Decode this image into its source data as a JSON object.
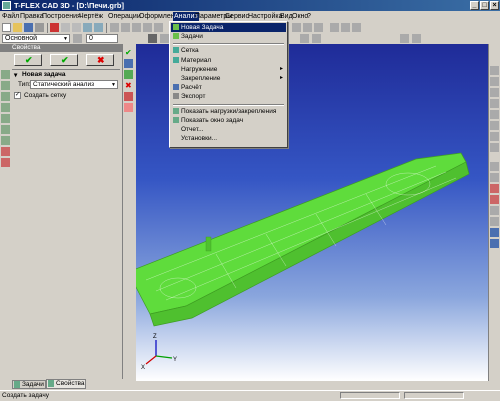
{
  "window": {
    "title": "T-FLEX CAD 3D - [D:\\Печи.grb]"
  },
  "menu": [
    "Файл",
    "Правка",
    "Построения",
    "Чертёж",
    "Операции",
    "Оформление",
    "Анализ",
    "Параметры",
    "Сервис",
    "Настройка",
    "Вид",
    "Окно",
    "?"
  ],
  "active_menu_index": 6,
  "toolbar": {
    "layer_value": "Основной",
    "number_value": "0"
  },
  "panel": {
    "header": "Свойства",
    "section_title": "Новая задача",
    "type_label": "Тип:",
    "type_value": "Статический анализ",
    "create_mesh_label": "Создать сетку",
    "create_mesh_checked": true,
    "tabs": [
      "Задачи",
      "Свойства"
    ]
  },
  "analysis_menu": {
    "items": [
      {
        "label": "Новая Задача",
        "icon": "new-task-icon",
        "highlight": true
      },
      {
        "label": "Задачи",
        "icon": "tasks-icon"
      },
      {
        "sep": true
      },
      {
        "label": "Сетка",
        "icon": "mesh-icon"
      },
      {
        "label": "Материал",
        "icon": "material-icon"
      },
      {
        "label": "Нагружение",
        "submenu": true
      },
      {
        "label": "Закрепление",
        "submenu": true
      },
      {
        "label": "Расчёт",
        "icon": "calculate-icon"
      },
      {
        "label": "Экспорт",
        "icon": "export-icon"
      },
      {
        "sep": true
      },
      {
        "label": "Показать нагрузки/закрепления",
        "icon": "show-loads-icon"
      },
      {
        "label": "Показать окно задач",
        "icon": "show-tasks-window-icon"
      },
      {
        "label": "Отчет..."
      },
      {
        "label": "Установки..."
      }
    ]
  },
  "status": {
    "text": "Создать задачу"
  },
  "colors": {
    "model_green": "#5fdc3c",
    "menu_highlight": "#0a246a"
  }
}
